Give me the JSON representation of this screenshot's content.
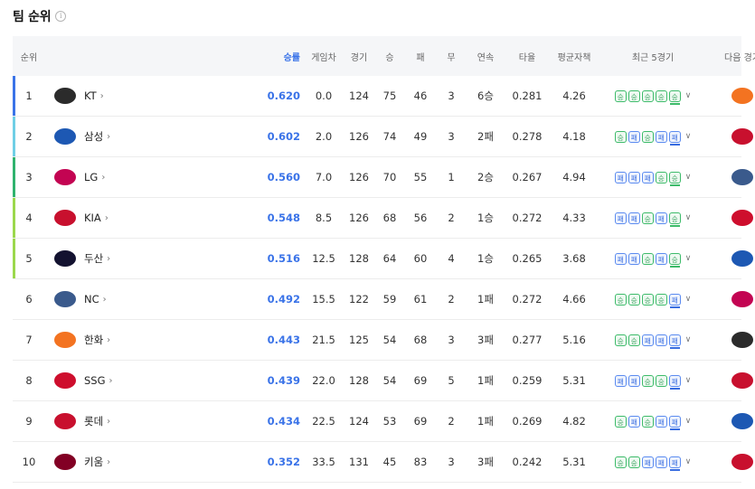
{
  "page": {
    "title": "팀 순위",
    "info_icon": "i"
  },
  "columns": {
    "rank": "순위",
    "pct": "승률",
    "gb": "게임차",
    "games": "경기",
    "wins": "승",
    "losses": "패",
    "draws": "무",
    "streak": "연속",
    "avg": "타율",
    "era": "평균자책",
    "last5": "최근 5경기",
    "next": "다음 경기"
  },
  "colors": {
    "accent": "#3a73e8",
    "win": "#3dbb6a",
    "loss": "#3a6ee0"
  },
  "rows": [
    {
      "rank": "1",
      "team": "KT",
      "pct": "0.620",
      "gb": "0.0",
      "games": "124",
      "wins": "75",
      "losses": "46",
      "draws": "3",
      "streak": "6승",
      "avg": "0.281",
      "era": "4.26",
      "last5": [
        "승",
        "승",
        "승",
        "승",
        "승"
      ],
      "bar": "#3a73e8",
      "logo": "#2b2b2b",
      "next_logo": "#f37321",
      "next_team": "한화"
    },
    {
      "rank": "2",
      "team": "삼성",
      "pct": "0.602",
      "gb": "2.0",
      "games": "126",
      "wins": "74",
      "losses": "49",
      "draws": "3",
      "streak": "2패",
      "avg": "0.278",
      "era": "4.18",
      "last5": [
        "승",
        "패",
        "승",
        "패",
        "패"
      ],
      "bar": "#6fcfe6",
      "logo": "#1d58b3",
      "next_logo": "#c8102e",
      "next_team": "롯데"
    },
    {
      "rank": "3",
      "team": "LG",
      "pct": "0.560",
      "gb": "7.0",
      "games": "126",
      "wins": "70",
      "losses": "55",
      "draws": "1",
      "streak": "2승",
      "avg": "0.267",
      "era": "4.94",
      "last5": [
        "패",
        "패",
        "패",
        "승",
        "승"
      ],
      "bar": "#2fb36e",
      "logo": "#c30452",
      "next_logo": "#3a5a8c",
      "next_team": "NC"
    },
    {
      "rank": "4",
      "team": "KIA",
      "pct": "0.548",
      "gb": "8.5",
      "games": "126",
      "wins": "68",
      "losses": "56",
      "draws": "2",
      "streak": "1승",
      "avg": "0.272",
      "era": "4.33",
      "last5": [
        "패",
        "패",
        "승",
        "패",
        "승"
      ],
      "bar": "#9bd84c",
      "logo": "#c8102e",
      "next_logo": "#ce0e2d",
      "next_team": "SSG"
    },
    {
      "rank": "5",
      "team": "두산",
      "pct": "0.516",
      "gb": "12.5",
      "games": "128",
      "wins": "64",
      "losses": "60",
      "draws": "4",
      "streak": "1승",
      "avg": "0.265",
      "era": "3.68",
      "last5": [
        "패",
        "패",
        "승",
        "패",
        "승"
      ],
      "bar": "#9bd84c",
      "logo": "#131230",
      "next_logo": "#1d58b3",
      "next_team": "삼성"
    },
    {
      "rank": "6",
      "team": "NC",
      "pct": "0.492",
      "gb": "15.5",
      "games": "122",
      "wins": "59",
      "losses": "61",
      "draws": "2",
      "streak": "1패",
      "avg": "0.272",
      "era": "4.66",
      "last5": [
        "승",
        "승",
        "승",
        "승",
        "패"
      ],
      "bar": "",
      "logo": "#3a5a8c",
      "next_logo": "#c30452",
      "next_team": "LG"
    },
    {
      "rank": "7",
      "team": "한화",
      "pct": "0.443",
      "gb": "21.5",
      "games": "125",
      "wins": "54",
      "losses": "68",
      "draws": "3",
      "streak": "3패",
      "avg": "0.277",
      "era": "5.16",
      "last5": [
        "승",
        "승",
        "패",
        "패",
        "패"
      ],
      "bar": "",
      "logo": "#f37321",
      "next_logo": "#2b2b2b",
      "next_team": "KT"
    },
    {
      "rank": "8",
      "team": "SSG",
      "pct": "0.439",
      "gb": "22.0",
      "games": "128",
      "wins": "54",
      "losses": "69",
      "draws": "5",
      "streak": "1패",
      "avg": "0.259",
      "era": "5.31",
      "last5": [
        "패",
        "패",
        "승",
        "승",
        "패"
      ],
      "bar": "",
      "logo": "#ce0e2d",
      "next_logo": "#c8102e",
      "next_team": "KIA"
    },
    {
      "rank": "9",
      "team": "롯데",
      "pct": "0.434",
      "gb": "22.5",
      "games": "124",
      "wins": "53",
      "losses": "69",
      "draws": "2",
      "streak": "1패",
      "avg": "0.269",
      "era": "4.82",
      "last5": [
        "승",
        "패",
        "승",
        "패",
        "패"
      ],
      "bar": "",
      "logo": "#c8102e",
      "next_logo": "#1d58b3",
      "next_team": "삼성"
    },
    {
      "rank": "10",
      "team": "키움",
      "pct": "0.352",
      "gb": "33.5",
      "games": "131",
      "wins": "45",
      "losses": "83",
      "draws": "3",
      "streak": "3패",
      "avg": "0.242",
      "era": "5.31",
      "last5": [
        "승",
        "승",
        "패",
        "패",
        "패"
      ],
      "bar": "",
      "logo": "#820024",
      "next_logo": "#c8102e",
      "next_team": "KIA"
    }
  ]
}
